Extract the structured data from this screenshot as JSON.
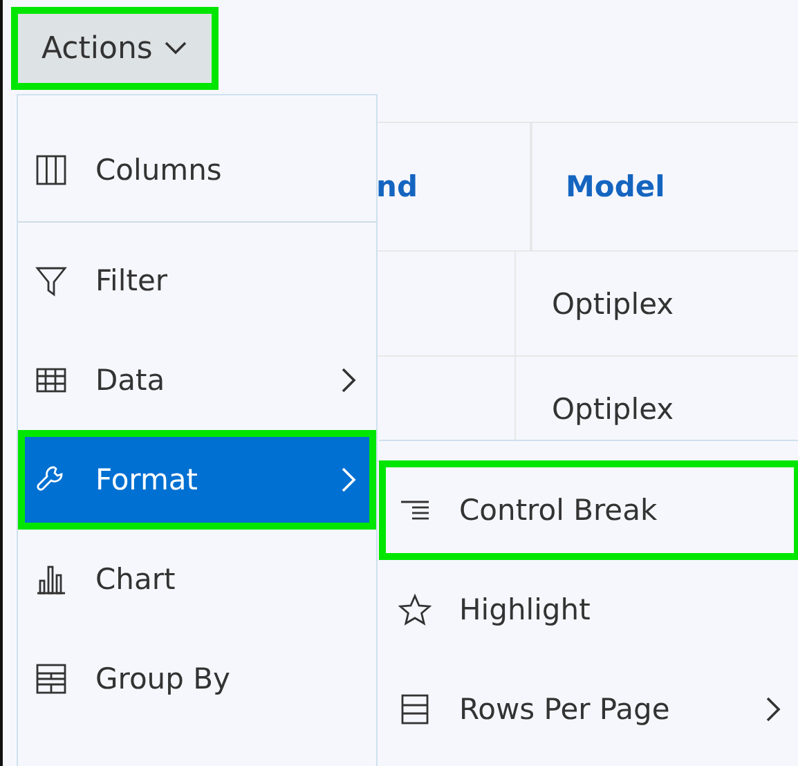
{
  "actions_button": {
    "label": "Actions",
    "highlighted": true
  },
  "table": {
    "columns": [
      "nd",
      "Model"
    ],
    "rows": [
      [
        "Optiplex"
      ],
      [
        "Optiplex"
      ]
    ]
  },
  "menu": {
    "items": [
      {
        "label": "Columns",
        "selected": false,
        "submenu": false,
        "highlighted": false
      },
      {
        "label": "Filter",
        "selected": false,
        "submenu": false,
        "highlighted": false
      },
      {
        "label": "Data",
        "selected": false,
        "submenu": true,
        "highlighted": false
      },
      {
        "label": "Format",
        "selected": true,
        "submenu": true,
        "highlighted": true
      },
      {
        "label": "Chart",
        "selected": false,
        "submenu": false,
        "highlighted": false
      },
      {
        "label": "Group By",
        "selected": false,
        "submenu": false,
        "highlighted": false
      }
    ]
  },
  "submenu": {
    "items": [
      {
        "label": "Control Break",
        "selected": false,
        "submenu": false,
        "highlighted": true
      },
      {
        "label": "Highlight",
        "selected": false,
        "submenu": false,
        "highlighted": false
      },
      {
        "label": "Rows Per Page",
        "selected": false,
        "submenu": true,
        "highlighted": false
      }
    ]
  }
}
